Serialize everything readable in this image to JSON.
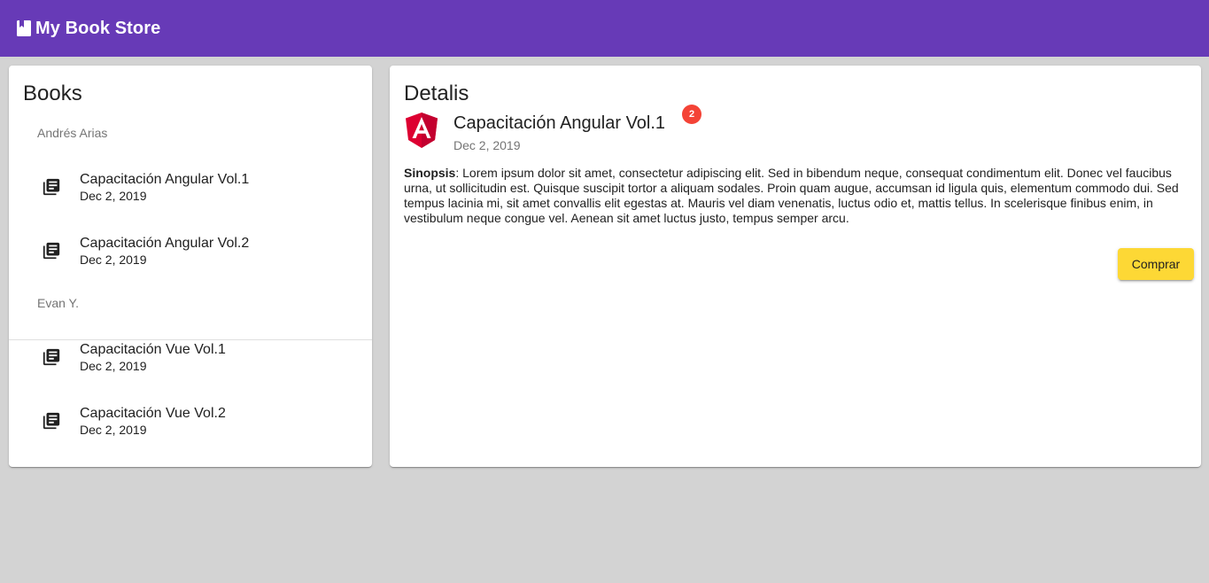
{
  "toolbar": {
    "title": "My Book Store",
    "icon": "book-icon"
  },
  "books": {
    "title": "Books",
    "groups": [
      {
        "author": "Andrés Arias",
        "items": [
          {
            "title": "Capacitación Angular Vol.1",
            "date": "Dec 2, 2019",
            "icon": "library-books-icon"
          },
          {
            "title": "Capacitación Angular Vol.2",
            "date": "Dec 2, 2019",
            "icon": "library-books-icon"
          }
        ]
      },
      {
        "author": "Evan Y.",
        "items": [
          {
            "title": "Capacitación Vue Vol.1",
            "date": "Dec 2, 2019",
            "icon": "library-books-icon"
          },
          {
            "title": "Capacitación Vue Vol.2",
            "date": "Dec 2, 2019",
            "icon": "library-books-icon"
          }
        ]
      }
    ]
  },
  "details": {
    "title": "Detalis",
    "book_title": "Capacitación Angular Vol.1",
    "badge": "2",
    "date": "Dec 2, 2019",
    "avatar": "angular-logo-icon",
    "synopsis_label": "Sinopsis",
    "synopsis_text": ": Lorem ipsum dolor sit amet, consectetur adipiscing elit. Sed in bibendum neque, consequat condimentum elit. Donec vel faucibus urna, ut sollicitudin est. Quisque suscipit tortor a aliquam sodales. Proin quam augue, accumsan id ligula quis, elementum commodo dui. Sed tempus lacinia mi, sit amet convallis elit egestas at. Mauris vel diam venenatis, luctus odio et, mattis tellus. In scelerisque finibus enim, in vestibulum neque congue vel. Aenean sit amet luctus justo, tempus semper arcu.",
    "buy_label": "Comprar"
  },
  "colors": {
    "primary": "#673ab7",
    "accent": "#fdd835",
    "badge": "#f44336",
    "background": "#d3d3d3"
  }
}
